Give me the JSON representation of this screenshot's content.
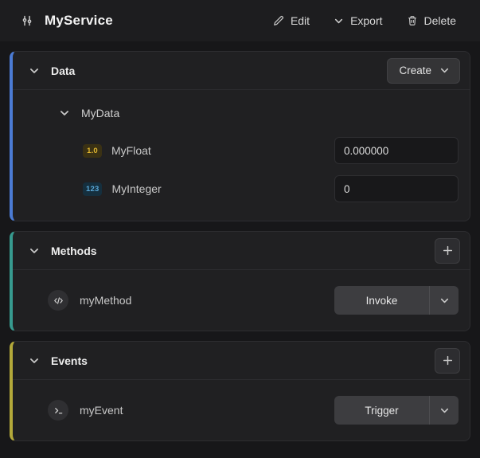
{
  "header": {
    "title": "MyService",
    "actions": {
      "edit": "Edit",
      "export": "Export",
      "delete": "Delete"
    }
  },
  "data_section": {
    "title": "Data",
    "create_label": "Create",
    "accent_color": "#4b7bd4",
    "group": {
      "name": "MyData",
      "fields": [
        {
          "type": "float",
          "badge": "1.0",
          "name": "MyFloat",
          "value": "0.000000"
        },
        {
          "type": "integer",
          "badge": "123",
          "name": "MyInteger",
          "value": "0"
        }
      ]
    }
  },
  "methods_section": {
    "title": "Methods",
    "accent_color": "#379a8f",
    "items": [
      {
        "name": "myMethod",
        "action_label": "Invoke"
      }
    ]
  },
  "events_section": {
    "title": "Events",
    "accent_color": "#b3a93a",
    "items": [
      {
        "name": "myEvent",
        "action_label": "Trigger"
      }
    ]
  },
  "icons": {
    "service": "sliders",
    "edit": "pencil",
    "export": "chevron-down",
    "delete": "trash",
    "section_toggle": "chevron-down",
    "add": "plus",
    "method": "code-brackets",
    "event": "terminal-prompt"
  },
  "colors": {
    "background": "#171719",
    "panel": "#202022",
    "data_accent": "#4b7bd4",
    "methods_accent": "#379a8f",
    "events_accent": "#b3a93a",
    "float_badge": "#e0b62f",
    "integer_badge": "#58a6d6"
  }
}
